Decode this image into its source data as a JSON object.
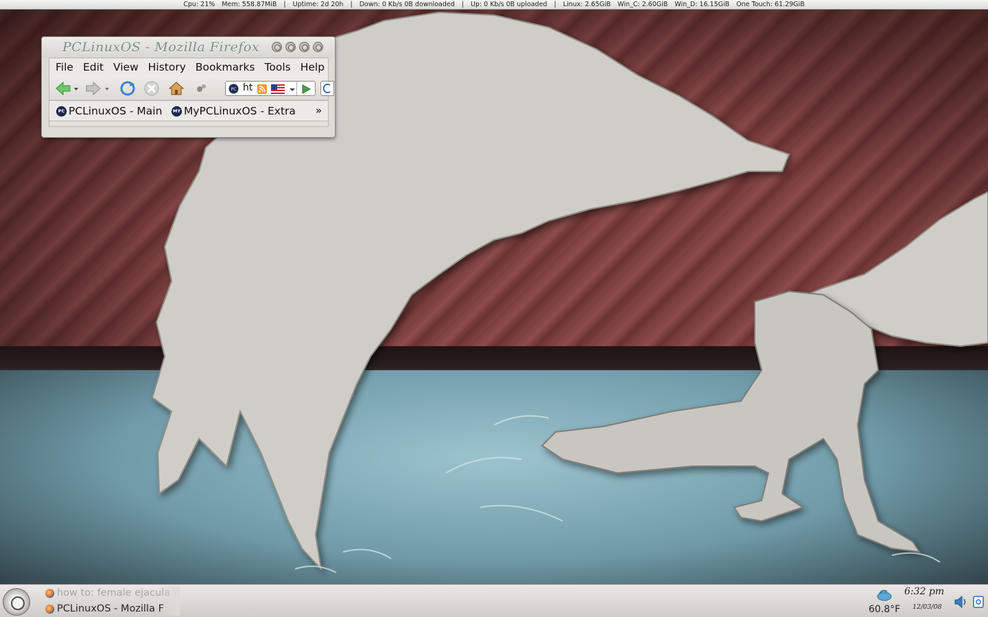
{
  "system_monitor": {
    "cpu": "Cpu: 21%",
    "mem": "Mem: 558.87MiB",
    "sep1": "|",
    "uptime": "Uptime: 2d 20h",
    "sep2": "|",
    "down": "Down: 0 Kb/s  0B downloaded",
    "sep3": "|",
    "up": "Up:  0 Kb/s  0B uploaded",
    "sep4": "|",
    "linux": "Linux: 2.65GiB",
    "win_c": "Win_C: 2.60GiB",
    "win_d": "Win_D: 16.15GiB",
    "one_touch": "One Touch: 61.29GiB"
  },
  "firefox": {
    "title": "PCLinuxOS - Mozilla Firefox",
    "menu": [
      "File",
      "Edit",
      "View",
      "History",
      "Bookmarks",
      "Tools",
      "Help"
    ],
    "url_text": "ht",
    "bookmarks": [
      {
        "label": "PCLinuxOS - Main",
        "favicon": "PC"
      },
      {
        "label": "MyPCLinuxOS - Extra",
        "favicon": "MY"
      }
    ],
    "bookmarks_overflow": "»",
    "icons": {
      "back": "back-arrow-icon",
      "forward": "forward-arrow-icon",
      "reload": "reload-icon",
      "stop": "stop-icon",
      "home": "home-icon",
      "go": "go-icon"
    }
  },
  "taskbar": {
    "tasks": [
      {
        "label": "how to: female ejacula",
        "state": "inactive"
      },
      {
        "label": "PCLinuxOS - Mozilla F",
        "state": "active"
      }
    ]
  },
  "tray": {
    "temperature": "60.8°F",
    "time": "6:32 pm",
    "date": "12/03/08"
  },
  "colors": {
    "wall_red": "#7a3e3e",
    "wall_floor": "#9cc4cf",
    "panel": "#e9e8e4",
    "title_text": "#7a8d8c"
  }
}
